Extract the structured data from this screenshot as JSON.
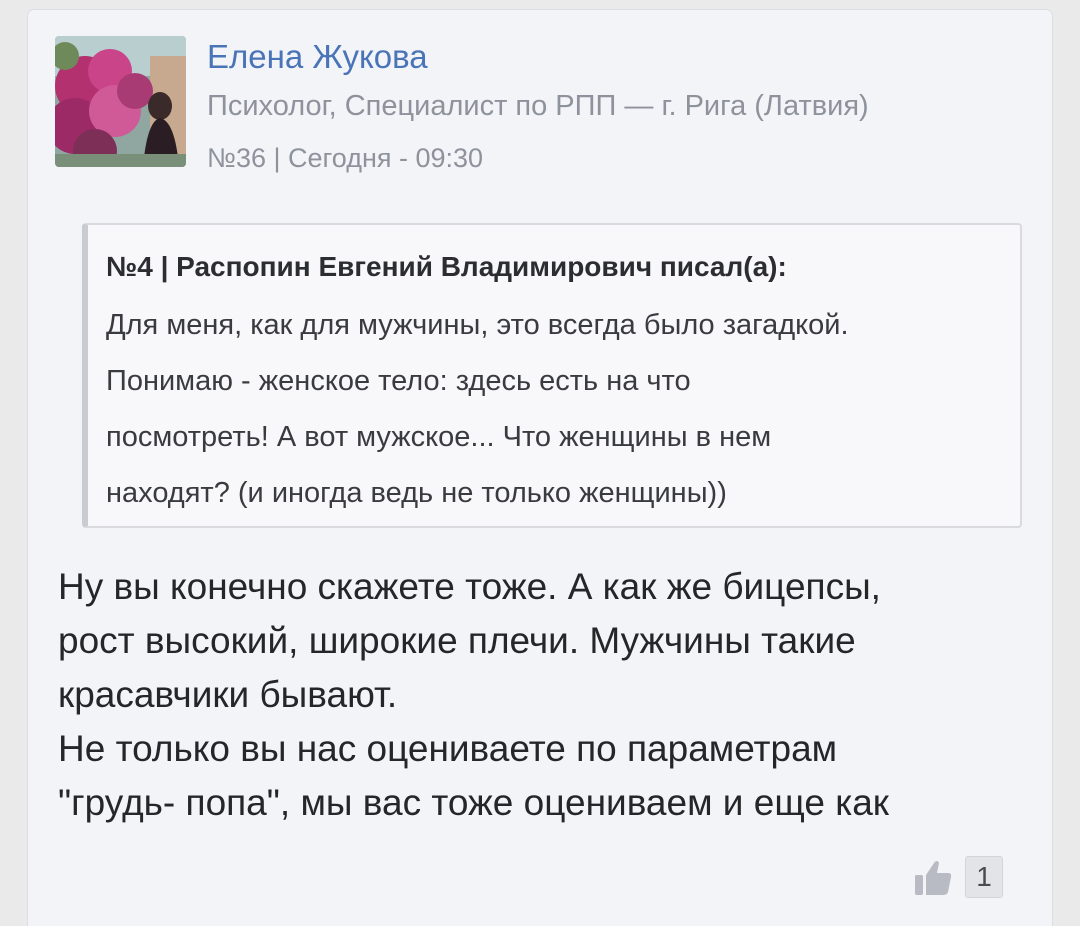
{
  "post": {
    "author": {
      "name": "Елена Жукова",
      "role": "Психолог, Специалист по РПП — г. Рига (Латвия)",
      "avatar_icon": "user-photo-avatar"
    },
    "meta": "№36 | Сегодня - 09:30",
    "quote": {
      "header": "№4 | Распопин Евгений Владимирович писал(а):",
      "lines": [
        "Для меня, как для мужчины, это всегда было загадкой.",
        "Понимаю - женское тело: здесь есть на что",
        "посмотреть! А вот мужское... Что женщины в нем",
        "находят? (и иногда ведь не только женщины))"
      ]
    },
    "message_lines": [
      "Ну вы конечно скажете тоже. А как же бицепсы,",
      "рост высокий, широкие плечи. Мужчины такие",
      "красавчики бывают.",
      "Не только вы нас оцениваете по параметрам",
      "\"грудь- попа\", мы вас тоже оцениваем и еще как"
    ],
    "likes": {
      "icon": "thumbs-up-icon",
      "count": "1"
    }
  },
  "colors": {
    "author_name": "#4a74b8",
    "muted_text": "#8e929c",
    "card_bg": "#f3f4f7",
    "page_bg": "#eaeaea"
  }
}
